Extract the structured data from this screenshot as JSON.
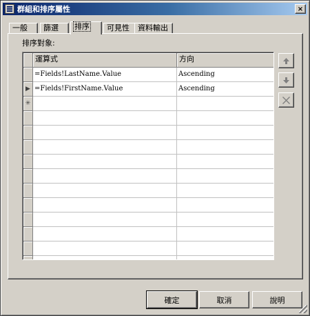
{
  "window": {
    "title": "群組和排序屬性",
    "close_label": "×"
  },
  "tabs": [
    {
      "label": "一般",
      "active": false
    },
    {
      "label": "篩選",
      "active": false
    },
    {
      "label": "排序",
      "active": true
    },
    {
      "label": "可見性",
      "active": false
    },
    {
      "label": "資料輸出",
      "active": false
    }
  ],
  "sort": {
    "section_label": "排序對象:",
    "columns": [
      "運算式",
      "方向"
    ],
    "rows": [
      {
        "expression": "=Fields!LastName.Value",
        "direction": "Ascending",
        "indicator": ""
      },
      {
        "expression": "=Fields!FirstName.Value",
        "direction": "Ascending",
        "indicator": "▶"
      },
      {
        "expression": "",
        "direction": "",
        "indicator": "✳"
      }
    ],
    "side_buttons": [
      "move-up-icon",
      "move-down-icon",
      "delete-icon"
    ]
  },
  "footer": {
    "ok_label": "確定",
    "cancel_label": "取消",
    "help_label": "說明"
  },
  "colors": {
    "face": "#d4d0c8",
    "title_start": "#0a246a",
    "title_end": "#a6caf0"
  }
}
